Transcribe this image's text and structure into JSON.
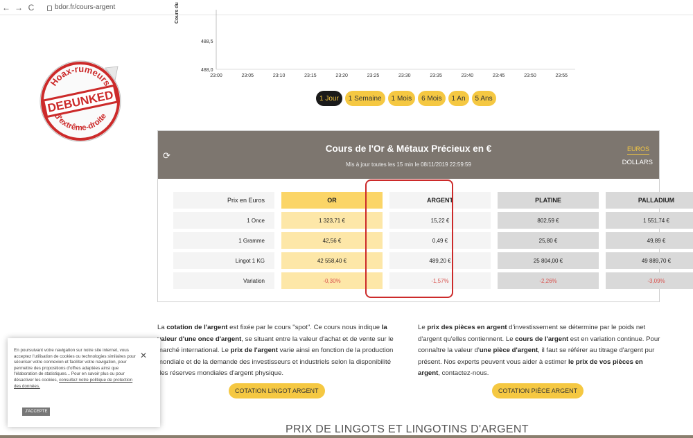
{
  "browser": {
    "back": "←",
    "forward": "→",
    "reload": "C",
    "url": "bdor.fr/cours-argent"
  },
  "chart": {
    "ylabel": "Cours du",
    "y_ticks": [
      "488,5",
      "488,0"
    ],
    "x_ticks": [
      "23:00",
      "23:05",
      "23:10",
      "23:15",
      "23:20",
      "23:25",
      "23:30",
      "23:35",
      "23:40",
      "23:45",
      "23:50",
      "23:55"
    ]
  },
  "chart_data": {
    "type": "line",
    "xlabel": "",
    "ylabel": "Cours du",
    "x": [
      "23:00",
      "23:05",
      "23:10",
      "23:15",
      "23:20",
      "23:25",
      "23:30",
      "23:35",
      "23:40",
      "23:45",
      "23:50",
      "23:55"
    ],
    "y_ticks": [
      488.0,
      488.5
    ],
    "ylim": [
      488.0,
      489.0
    ],
    "series": []
  },
  "periods": [
    {
      "label": "1 Jour",
      "active": true
    },
    {
      "label": "1 Semaine",
      "active": false
    },
    {
      "label": "1 Mois",
      "active": false
    },
    {
      "label": "6 Mois",
      "active": false
    },
    {
      "label": "1 An",
      "active": false
    },
    {
      "label": "5 Ans",
      "active": false
    }
  ],
  "sticker": {
    "top": "Hoax-rumeurs",
    "middle": "DEBUNKED",
    "bottom": "d'extrême-droite",
    "color": "#cc2a2a"
  },
  "table": {
    "title": "Cours de l'Or & Métaux Précieux en €",
    "subtitle": "Mis à jour toutes les 15 min le 08/11/2019 22:59:59",
    "currency_active": "EUROS",
    "currency_other": "DOLLARS",
    "header": [
      "Prix en Euros",
      "OR",
      "ARGENT",
      "PLATINE",
      "PALLADIUM"
    ],
    "rows": [
      {
        "label": "1 Once",
        "or": "1 323,71 €",
        "argent": "15,22 €",
        "platine": "802,59 €",
        "palladium": "1 551,74 €"
      },
      {
        "label": "1 Gramme",
        "or": "42,56 €",
        "argent": "0,49 €",
        "platine": "25,80 €",
        "palladium": "49,89 €"
      },
      {
        "label": "Lingot 1 KG",
        "or": "42 558,40 €",
        "argent": "489,20 €",
        "platine": "25 804,00 €",
        "palladium": "49 889,70 €"
      },
      {
        "label": "Variation",
        "or": "-0,30%",
        "argent": "-1,57%",
        "platine": "-2,26%",
        "palladium": "-3,09%"
      }
    ]
  },
  "para_left": {
    "t1": "La ",
    "b1": "cotation de l'argent",
    "t2": " est fixée par le cours \"spot\". Ce cours nous indique ",
    "b2": "la valeur d'une once d'argent",
    "t3": ", se situant entre la valeur d'achat et de vente sur le marché international. Le ",
    "b3": "prix de l'argent",
    "t4": " varie ainsi en fonction de la production mondiale et de la demande des investisseurs et industriels selon la disponibilité des réserves mondiales d'argent physique."
  },
  "para_right": {
    "t1": "Le ",
    "b1": "prix des pièces en argent",
    "t2": " d'investissement se détermine par le poids net d'argent qu'elles contiennent. Le ",
    "b2": "cours de l'argent",
    "t3": " est en variation continue. Pour connaître la valeur d'",
    "b3": "une pièce d'argent",
    "t4": ", il faut se référer au titrage d'argent pur présent. Nos experts peuvent vous aider à estimer ",
    "b4": "le prix de vos pièces en argent",
    "t5": ", contactez-nous."
  },
  "cta_left": "COTATION LINGOT ARGENT",
  "cta_right": "COTATION PIÈCE ARGENT",
  "section_title": "PRIX DE LINGOTS ET LINGOTINS D'ARGENT",
  "cookie": {
    "text": "En poursuivant votre navigation sur notre site internet, vous acceptez l'utilisation de cookies ou technologies similaires pour sécuriser votre connexion et faciliter votre navigation, pour permettre des propositions d'offres adaptées ainsi que l'élaboration de statistiques... Pour en savoir plus ou pour désactiver les cookies, ",
    "link": "consultez notre politique de protection des données.",
    "close": "✕",
    "accept": "J'ACCEPTE"
  }
}
